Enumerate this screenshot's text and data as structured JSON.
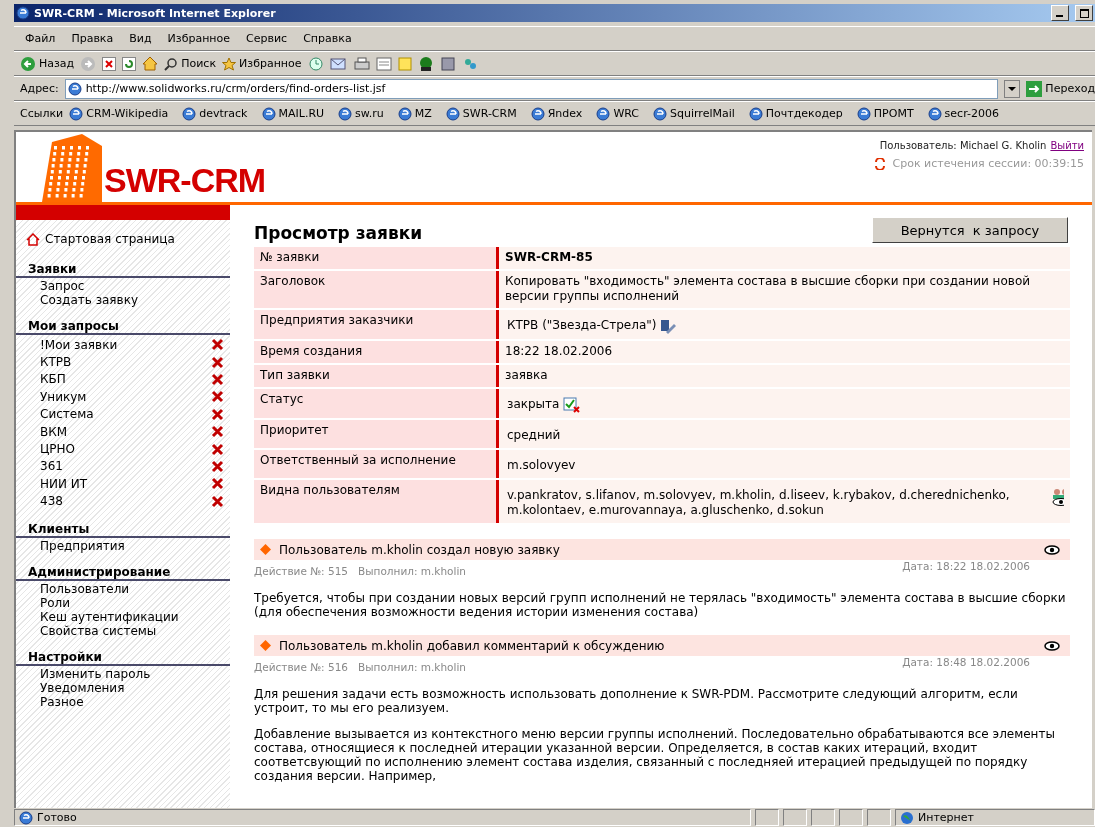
{
  "window": {
    "title": "SWR-CRM - Microsoft Internet Explorer"
  },
  "menu": [
    "Файл",
    "Правка",
    "Вид",
    "Избранное",
    "Сервис",
    "Справка"
  ],
  "toolbar": {
    "back": "Назад",
    "search": "Поиск",
    "favorites": "Избранное"
  },
  "address": {
    "label": "Адрес:",
    "url": "http://www.solidworks.ru/crm/orders/find-orders-list.jsf",
    "go": "Переход"
  },
  "links": {
    "label": "Ссылки",
    "items": [
      "CRM-Wikipedia",
      "devtrack",
      "MAIL.RU",
      "sw.ru",
      "MZ",
      "SWR-CRM",
      "Яndex",
      "WRC",
      "SquirrelMail",
      "Почтдекодер",
      "ПРОМТ",
      "secr-2006"
    ]
  },
  "header": {
    "logo": "SWR-CRM",
    "user_label": "Пользователь:",
    "user": "Michael G. Kholin",
    "logout": "Выйти",
    "session": "Срок истечения сессии: 00:39:15"
  },
  "sidebar": {
    "home": "Стартовая страница",
    "sections": [
      {
        "title": "Заявки",
        "deletable": false,
        "items": [
          "Запрос",
          "Создать заявку"
        ]
      },
      {
        "title": "Мои запросы",
        "deletable": true,
        "items": [
          "!Мои заявки",
          "КТРВ",
          "КБП",
          "Уникум",
          "Система",
          "ВКМ",
          "ЦРНО",
          "361",
          "НИИ ИТ",
          "438"
        ]
      },
      {
        "title": "Клиенты",
        "deletable": false,
        "items": [
          "Предприятия"
        ]
      },
      {
        "title": "Администрирование",
        "deletable": false,
        "items": [
          "Пользователи",
          "Роли",
          "Кеш аутентификации",
          "Свойства системы"
        ]
      },
      {
        "title": "Настройки",
        "deletable": false,
        "items": [
          "Изменить пароль",
          "Уведомления",
          "Разное"
        ]
      }
    ]
  },
  "page": {
    "title": "Просмотр заявки",
    "back_button": "Вернутся  к запросу"
  },
  "details": [
    {
      "label": "№ заявки",
      "value": "SWR-CRM-85",
      "kind": "id"
    },
    {
      "label": "Заголовок",
      "value": "Копировать \"входимость\" элемента состава в высшие сборки при создании новой версии группы исполнений",
      "kind": "text"
    },
    {
      "label": "Предприятия заказчики",
      "value": "КТРВ (\"Звезда-Стрела\")",
      "kind": "client"
    },
    {
      "label": "Время создания",
      "value": "18:22 18.02.2006",
      "kind": "text"
    },
    {
      "label": "Тип заявки",
      "value": "заявка",
      "kind": "text"
    },
    {
      "label": "Статус",
      "value": "закрыта",
      "kind": "status"
    },
    {
      "label": "Приоритет",
      "value": "средний",
      "kind": "padded"
    },
    {
      "label": "Ответственный за исполнение",
      "value": "m.solovyev",
      "kind": "padded"
    },
    {
      "label": "Видна пользователям",
      "value": "v.pankratov, s.lifanov, m.solovyev, m.kholin, d.liseev, k.rybakov, d.cherednichenko, m.kolontaev, e.murovannaya, a.gluschenko, d.sokun",
      "kind": "users"
    }
  ],
  "actions": [
    {
      "title": "Пользователь m.kholin создал новую заявку",
      "number": "Действие №: 515",
      "performer": "Выполнил: m.kholin",
      "date": "Дата: 18:22 18.02.2006",
      "paragraphs": [
        "Требуется, чтобы при создании новых версий групп исполнений не терялась \"входимость\" элемента состава в высшие сборки (для обеспечения возможности ведения истории изменения состава)"
      ]
    },
    {
      "title": "Пользователь m.kholin добавил комментарий к обсуждению",
      "number": "Действие №: 516",
      "performer": "Выполнил: m.kholin",
      "date": "Дата: 18:48 18.02.2006",
      "paragraphs": [
        "Для решения задачи есть возможность использовать дополнение к SWR-PDM. Рассмотрите следующий алгоритм, если устроит, то мы его реализуем.",
        "Добавление вызывается из контекстного меню версии группы исполнений. Последовательно обрабатываются все элементы состава, относящиеся к последней итерации указанной версии. Определяется, в состав каких итераций, входит соответсвующий по исполнению элемент состава изделия, связанный с последняей итерацией предыдущей по порядку создания версии. Например,"
      ]
    }
  ],
  "status_bar": {
    "text": "Готово",
    "zone": "Интернет"
  }
}
